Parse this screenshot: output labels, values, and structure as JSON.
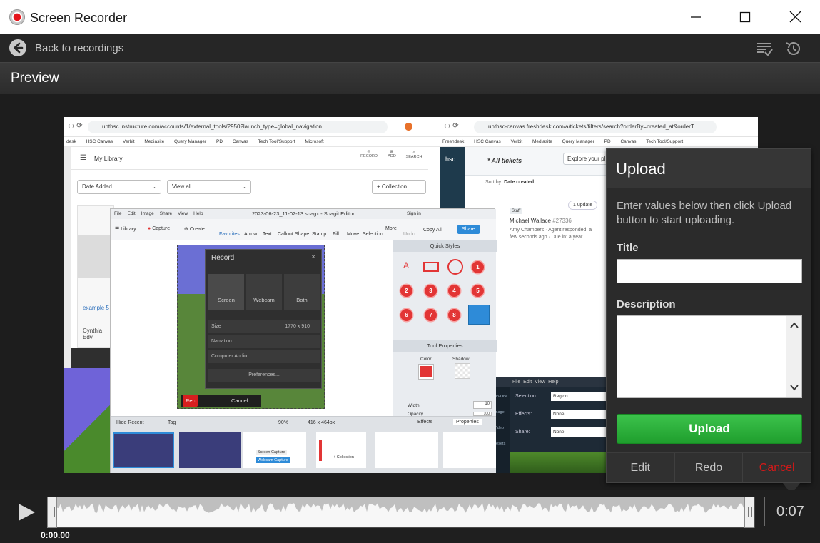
{
  "window": {
    "title": "Screen Recorder",
    "minimize_label": "Minimize",
    "maximize_label": "Maximize",
    "close_label": "Close"
  },
  "nav": {
    "back_label": "Back to recordings",
    "icons": [
      "checklist-icon",
      "history-icon"
    ]
  },
  "preview": {
    "title": "Preview"
  },
  "video": {
    "left_browser": {
      "url": "unthsc.instructure.com/accounts/1/external_tools/2950?launch_type=global_navigation",
      "bookmarks": [
        "desk",
        "HSC Canvas",
        "Verbit",
        "Mediasite",
        "Query Manager",
        "PD",
        "Canvas",
        "Tech Tool/Support",
        "Microsoft"
      ],
      "library_title": "My Library",
      "sort_label": "Date Added",
      "filter_label": "View all",
      "collection_label": "+ Collection",
      "top_icons": [
        "RECORD",
        "ADD",
        "SEARCH"
      ],
      "card_text_1": "example 5",
      "card_text_2": "Cynthia Edv"
    },
    "right_browser": {
      "url": "unthsc-canvas.freshdesk.com/a/tickets/filters/search?orderBy=created_at&orderT...",
      "bookmarks": [
        "Freshdesk",
        "HSC Canvas",
        "Verbit",
        "Mediasite",
        "Query Manager",
        "PD",
        "Canvas",
        "Tech Tool/Support"
      ],
      "tickets_label": "All tickets",
      "explore_label": "Explore your pl",
      "sort_by": "Sort by:",
      "sort_value": "Date created",
      "update_badge": "1 update",
      "staff_badge": "Staff",
      "ticket_author": "Michael Wallace",
      "ticket_id": "#27336",
      "ticket_line": "Amy Chambers · Agent responded: a",
      "ticket_time": "few seconds ago · Due in: a year"
    },
    "snagit": {
      "window_title": "2023-06-23_11-02-13.snagx - Snagit Editor",
      "menu": [
        "File",
        "Edit",
        "Image",
        "Share",
        "View",
        "Help"
      ],
      "sign_in": "Sign in",
      "library": "Library",
      "capture": "Capture",
      "create": "Create",
      "tools": [
        "Favorites",
        "Arrow",
        "Text",
        "Callout",
        "Shape",
        "Stamp",
        "Fill",
        "Move",
        "Selection"
      ],
      "more": "More",
      "undo": "Undo",
      "copy_all": "Copy All",
      "share": "Share",
      "quick_styles": "Quick Styles",
      "quick_numbers": [
        "1",
        "2",
        "3",
        "4",
        "5",
        "6",
        "7",
        "8"
      ],
      "tool_properties": "Tool Properties",
      "color_label": "Color",
      "shadow_label": "Shadow",
      "width_label": "Width",
      "width_value": "10",
      "opacity_label": "Opacity",
      "opacity_value": "100",
      "hide_recent": "Hide Recent",
      "tag": "Tag",
      "zoom": "90%",
      "size": "416 x 464px",
      "effects": "Effects",
      "properties": "Properties",
      "thumb_labels": [
        "Screen Capture",
        "Webcam Capture",
        "+ Collection"
      ]
    },
    "record_panel": {
      "title": "Record",
      "modes": [
        "Screen",
        "Webcam",
        "Both"
      ],
      "size_label": "Size",
      "size_value": "1770 x 910",
      "narration": "Narration",
      "computer_audio": "Computer Audio",
      "preferences": "Preferences...",
      "rec": "Rec",
      "cancel": "Cancel"
    },
    "capture_panel": {
      "menu": [
        "File",
        "Edit",
        "View",
        "Help"
      ],
      "all_in_one": "All-in-One",
      "image": "Image",
      "video": "Video",
      "presets": "Presets",
      "selection_label": "Selection:",
      "selection_value": "Region",
      "effects_label": "Effects:",
      "effects_value": "None",
      "share_label": "Share:",
      "share_value": "None"
    }
  },
  "upload": {
    "title": "Upload",
    "instructions": "Enter values below then click Upload button to start uploading.",
    "title_label": "Title",
    "title_value": "",
    "description_label": "Description",
    "description_value": "",
    "upload_button": "Upload",
    "edit": "Edit",
    "redo": "Redo",
    "cancel": "Cancel",
    "cancel_color": "#d21919",
    "upload_color": "#2db33b"
  },
  "timeline": {
    "current_time": "0:00.00",
    "total_time": "0:07"
  }
}
